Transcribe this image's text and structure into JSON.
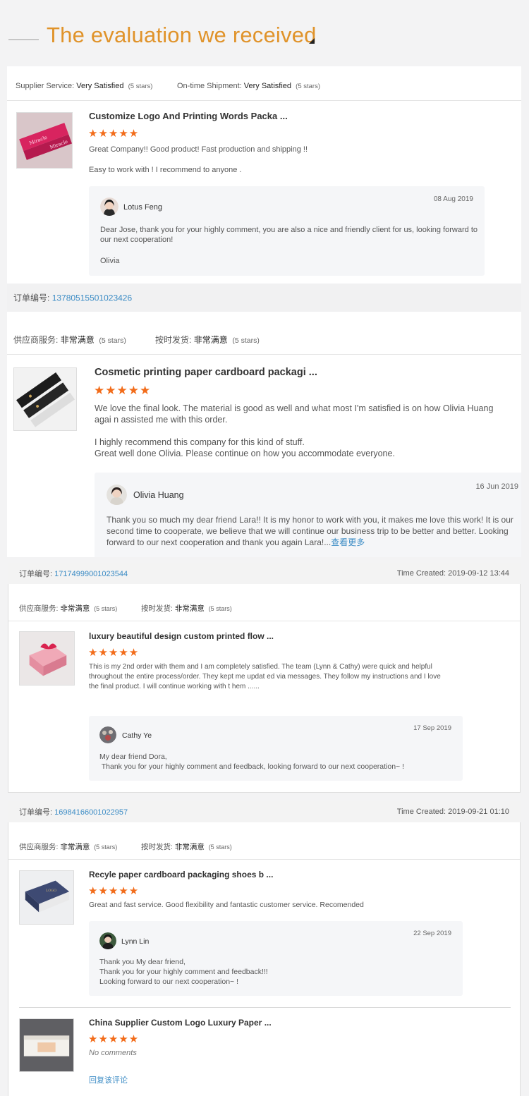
{
  "header": {
    "title": "The evaluation we received"
  },
  "colors": {
    "accent": "#e0932a",
    "star": "#f26c1a",
    "link": "#3c8cc5"
  },
  "review1": {
    "service_label": "Supplier Service:",
    "service_value": "Very Satisfied",
    "service_stars": "(5 stars)",
    "ship_label": "On-time Shipment:",
    "ship_value": "Very Satisfied",
    "ship_stars": "(5 stars)",
    "product_title": "Customize Logo And Printing Words Packa ...",
    "rating_stars": "★★★★★",
    "rating": 5,
    "comment_line1": "Great Company!! Good product! Fast production and shipping !!",
    "comment_line2": "Easy to work with ! I recommend to anyone .",
    "reply_name": "Lotus Feng",
    "reply_date": "08 Aug 2019",
    "reply_text": "Dear Jose, thank you for your highly comment, you are also a nice and friendly client for us, looking forward to our next cooperation!",
    "reply_sign": "Olivia"
  },
  "review2": {
    "order_label": "订单编号:",
    "order_number": "13780515501023426",
    "service_label": "供应商服务:",
    "service_value": "非常满意",
    "service_stars": "(5 stars)",
    "ship_label": "按时发货:",
    "ship_value": "非常满意",
    "ship_stars": "(5 stars)",
    "product_title": "Cosmetic printing paper cardboard packagi ...",
    "rating_stars": "★★★★★",
    "rating": 5,
    "comment_para1": "We love the final look. The material is good as well and what most I'm satisfied is on how Olivia Huang agai n assisted me with this order.",
    "comment_para2_line1": "I highly recommend this company for this kind of stuff.",
    "comment_para2_line2": "Great well done Olivia. Please continue on how you accommodate everyone.",
    "reply_name": "Olivia Huang",
    "reply_date": "16 Jun 2019",
    "reply_text": "Thank you so much my dear friend Lara!!  It is my honor to work with you, it makes me love this work! It is our second time to cooperate, we believe that we will continue our business trip to be better and better. Looking forward to our next cooperation and thank you again Lara!...",
    "see_more": "查看更多"
  },
  "review3": {
    "order_label": "订单编号:",
    "order_number": "17174999001023544",
    "time_created": "Time Created: 2019-09-12 13:44",
    "service_label": "供应商服务:",
    "service_value": "非常满意",
    "service_stars": "(5 stars)",
    "ship_label": "按时发货:",
    "ship_value": "非常满意",
    "ship_stars": "(5 stars)",
    "product_title": "luxury beautiful design custom printed flow ...",
    "rating_stars": "★★★★★",
    "rating": 5,
    "comment_text": "This is my 2nd order with them and I am completely satisfied. The team (Lynn & Cathy) were quick and helpful throughout the entire process/order.    They kept me updat ed via messages.       They follow my instructions and I love the final product.    I will continue working with t hem ......",
    "reply_name": "Cathy Ye",
    "reply_date": "17 Sep 2019",
    "reply_line1": "My dear friend Dora,",
    "reply_line2": " Thank you for your highly comment and feedback, looking forward to our next cooperation~ !"
  },
  "review4": {
    "order_label": "订单编号:",
    "order_number": "16984166001022957",
    "time_created": "Time Created: 2019-09-21 01:10",
    "service_label": "供应商服务:",
    "service_value": "非常满意",
    "service_stars": "(5 stars)",
    "ship_label": "按时发货:",
    "ship_value": "非常满意",
    "ship_stars": "(5 stars)",
    "product_title": "Recyle paper cardboard packaging shoes b ...",
    "rating_stars": "★★★★★",
    "rating": 5,
    "comment_text": "Great and fast service. Good flexibility and fantastic customer service. Recomended",
    "reply_name": "Lynn Lin",
    "reply_date": "22 Sep 2019",
    "reply_line1": "Thank you My dear friend,",
    "reply_line2": "Thank you for your highly comment and feedback!!!",
    "reply_line3": "Looking forward to our next cooperation~ !"
  },
  "review5": {
    "product_title": "China Supplier Custom Logo Luxury Paper  ...",
    "rating_stars": "★★★★★",
    "rating": 5,
    "no_comments": "No comments",
    "read_link": "回复该评论"
  }
}
